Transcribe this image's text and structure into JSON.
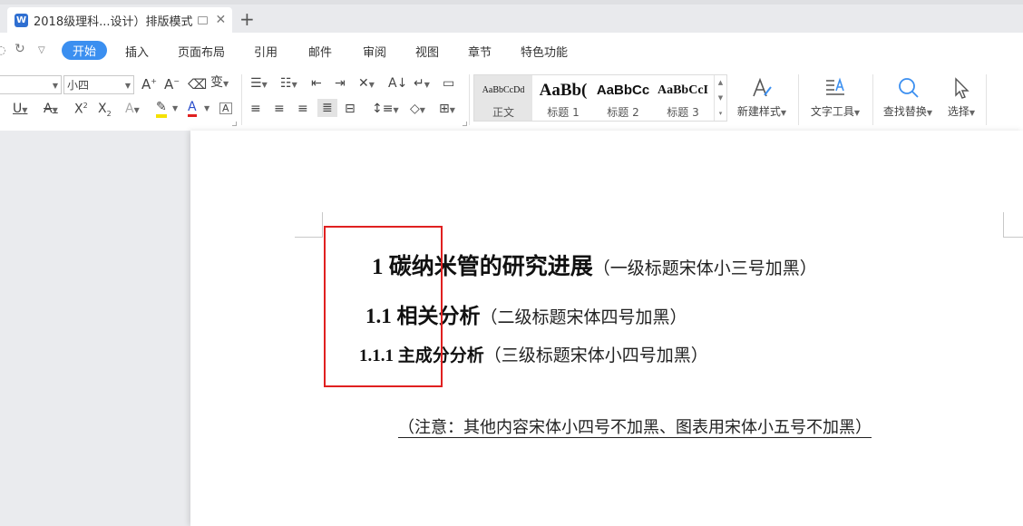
{
  "tab": {
    "title": "2018级理科...设计）排版模式",
    "app_icon_letter": "W",
    "new_tab_symbol": "+"
  },
  "menu": {
    "items": [
      "开始",
      "插入",
      "页面布局",
      "引用",
      "邮件",
      "审阅",
      "视图",
      "章节",
      "特色功能"
    ],
    "active": "开始",
    "quick_access": [
      "redo-icon",
      "dropdown-icon"
    ]
  },
  "ribbon": {
    "font_size_value": "小四",
    "font_buttons": [
      "grow-font-icon",
      "shrink-font-icon",
      "clear-format-icon",
      "phonetic-guide-icon"
    ],
    "format_buttons": [
      "underline-icon",
      "strikethrough-icon",
      "superscript-icon",
      "subscript-icon",
      "text-effect-icon",
      "highlight-icon",
      "font-color-icon",
      "char-border-icon"
    ],
    "para_buttons_row1": [
      "bullets-icon",
      "numbering-icon",
      "decrease-indent-icon",
      "increase-indent-icon",
      "chinese-layout-icon",
      "sort-icon",
      "show-marks-icon",
      "table-grid-icon"
    ],
    "para_buttons_row2": [
      "align-left-icon",
      "align-center-icon",
      "align-right-icon",
      "justify-icon",
      "distributed-icon",
      "line-spacing-icon",
      "shading-icon",
      "borders-icon"
    ],
    "styles": [
      {
        "sample": "AaBbCcDd",
        "name": "正文"
      },
      {
        "sample": "AaBb(",
        "name": "标题 1"
      },
      {
        "sample": "AaBbCc",
        "name": "标题 2"
      },
      {
        "sample": "AaBbCcI",
        "name": "标题 3"
      }
    ],
    "new_style_label": "新建样式",
    "text_tools_label": "文字工具",
    "find_replace_label": "查找替换",
    "select_label": "选择"
  },
  "document": {
    "h1_main": "1 碳纳米管的研究进展",
    "h1_note": "（一级标题宋体小三号加黑）",
    "h2_main": "1.1 相关分析",
    "h2_note": "（二级标题宋体四号加黑）",
    "h3_main": "1.1.1 主成分分析",
    "h3_note": "（三级标题宋体小四号加黑）",
    "note": "（注意：其他内容宋体小四号不加黑、图表用宋体小五号不加黑）"
  },
  "colors": {
    "accent": "#3b8ff0",
    "annotation": "#e02020",
    "highlight_yellow": "#f5e100",
    "font_color_red": "#e02020"
  }
}
